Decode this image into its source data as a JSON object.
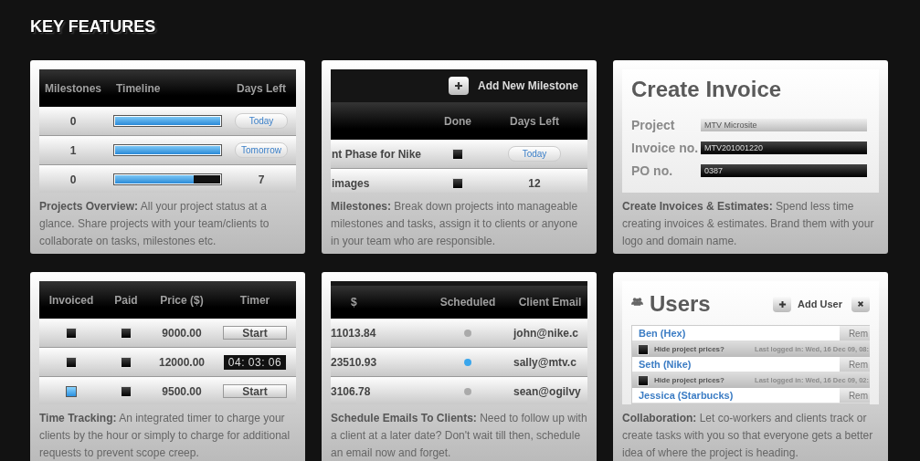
{
  "heading": "KEY FEATURES",
  "cards": [
    {
      "kind": "timeline",
      "columns": [
        "Milestones",
        "Timeline",
        "Days Left"
      ],
      "rows": [
        {
          "milestones": "0",
          "level": 1,
          "days": {
            "kind": "badge",
            "text": "Today"
          }
        },
        {
          "milestones": "1",
          "level": 1,
          "days": {
            "kind": "badge",
            "text": "Tomorrow"
          }
        },
        {
          "milestones": "0",
          "level": 0.75,
          "days": {
            "kind": "text",
            "text": "7"
          }
        }
      ],
      "description": "**Projects Overview:** All your project status at a glance. Share projects with your team/clients to collaborate on tasks, milestones etc."
    },
    {
      "kind": "milestones",
      "add_button": "Add New Milestone",
      "columns": [
        "Done",
        "Days Left"
      ],
      "rows": [
        {
          "task": "nt Phase for Nike",
          "done": false,
          "days": {
            "kind": "badge",
            "text": "Today"
          }
        },
        {
          "task": "images",
          "done": false,
          "days": {
            "kind": "text",
            "text": "12"
          }
        }
      ],
      "description": "**Milestones:** Break down projects into manageable milestones and tasks, assign it to clients or anyone in your team who are responsible."
    },
    {
      "kind": "invoice",
      "title": "Create Invoice",
      "fields": [
        {
          "label": "Project",
          "kind": "select",
          "value": "MTV Microsite"
        },
        {
          "label": "Invoice no.",
          "kind": "input",
          "value": "MTV201001220"
        },
        {
          "label": "PO no.",
          "kind": "input",
          "value": "0387"
        }
      ],
      "description": "**Create Invoices & Estimates:** Spend less time creating invoices & estimates. Brand them with your logo and domain name."
    },
    {
      "kind": "time",
      "columns": [
        "Invoiced",
        "Paid",
        "Price ($)",
        "Timer"
      ],
      "rows": [
        {
          "invoiced": false,
          "paid": false,
          "price": "9000.00",
          "timer": {
            "kind": "button",
            "text": "Start"
          }
        },
        {
          "invoiced": false,
          "paid": false,
          "price": "12000.00",
          "timer": {
            "kind": "clock",
            "text": "04: 03: 06"
          }
        },
        {
          "invoiced": true,
          "paid": false,
          "price": "9500.00",
          "timer": {
            "kind": "button",
            "text": "Start"
          }
        }
      ],
      "description": "**Time Tracking:** An integrated timer to charge your clients by the hour or simply to charge for additional requests to prevent scope creep."
    },
    {
      "kind": "emails",
      "columns": [
        "$",
        "Scheduled",
        "Client Email"
      ],
      "rows": [
        {
          "amount": "11013.84",
          "scheduled": false,
          "email": "john@nike.c"
        },
        {
          "amount": "23510.93",
          "scheduled": true,
          "email": "sally@mtv.c"
        },
        {
          "amount": "3106.78",
          "scheduled": false,
          "email": "sean@ogilvy"
        }
      ],
      "description": "**Schedule Emails To Clients:** Need to follow up with a client at a later date? Don't wait till then, schedule an email now and forget."
    },
    {
      "kind": "users",
      "title": "Users",
      "add_button": "Add User",
      "users": [
        {
          "name": "Ben (Hex)",
          "action": "Rem",
          "option": {
            "text": "Hide project prices?",
            "checked": false,
            "last_login": "Last logged in: Wed, 16 Dec 09, 08:"
          }
        },
        {
          "name": "Seth (Nike)",
          "action": "Rem",
          "option": {
            "text": "Hide project prices?",
            "checked": false,
            "last_login": "Last logged in: Wed, 16 Dec 09, 02:"
          }
        },
        {
          "name": "Jessica (Starbucks)",
          "action": "Rem"
        }
      ],
      "description": "**Collaboration:** Let co-workers and clients track or create tasks with you so that everyone gets a better idea of where the project is heading."
    }
  ]
}
